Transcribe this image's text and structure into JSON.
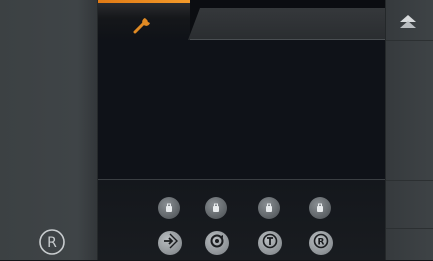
{
  "tabs": [
    {
      "id": "service",
      "icon": "wrench-icon",
      "active": true,
      "accent_color": "#f08c1e"
    },
    {
      "id": "blank",
      "active": false
    }
  ],
  "bottom_row_small": [
    {
      "icon": "tool-lock-icon"
    },
    {
      "icon": "tool-lock-icon"
    },
    {
      "icon": "tool-lock-icon"
    },
    {
      "icon": "tool-lock-icon"
    }
  ],
  "bottom_row_large": [
    {
      "icon": "enter-arrow-icon"
    },
    {
      "icon": "rotate-icon"
    },
    {
      "icon": "t-circle-icon"
    },
    {
      "icon": "r-circle-icon"
    }
  ],
  "left_rail": {
    "logo_icon": "r-logo-icon"
  },
  "right_rail": {
    "top_icon": "eject-icon"
  }
}
